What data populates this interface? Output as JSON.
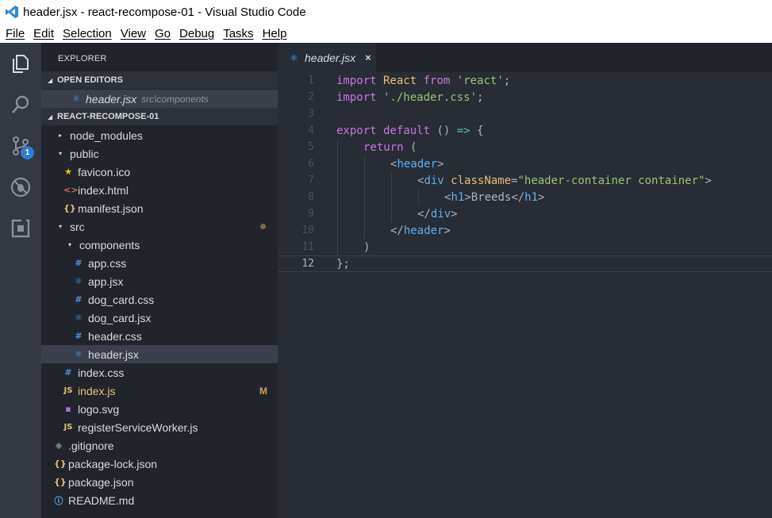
{
  "window": {
    "title": "header.jsx - react-recompose-01 - Visual Studio Code"
  },
  "menu": [
    "File",
    "Edit",
    "Selection",
    "View",
    "Go",
    "Debug",
    "Tasks",
    "Help"
  ],
  "activity": {
    "scm_badge": "1"
  },
  "sidebar": {
    "title": "EXPLORER",
    "open_editors_label": "OPEN EDITORS",
    "open_editor": {
      "name": "header.jsx",
      "path": "src\\components"
    },
    "project_label": "REACT-RECOMPOSE-01",
    "tree": [
      {
        "name": "node_modules",
        "icon": "",
        "arrow": "▸"
      },
      {
        "name": "public",
        "icon": "",
        "arrow": "▾"
      },
      {
        "name": "favicon.ico",
        "icon": "★"
      },
      {
        "name": "index.html",
        "icon": "<>"
      },
      {
        "name": "manifest.json",
        "icon": "{}"
      },
      {
        "name": "src",
        "icon": "",
        "arrow": "▾"
      },
      {
        "name": "components",
        "icon": "",
        "arrow": "▾"
      },
      {
        "name": "app.css",
        "icon": "#"
      },
      {
        "name": "app.jsx",
        "icon": "⚛"
      },
      {
        "name": "dog_card.css",
        "icon": "#"
      },
      {
        "name": "dog_card.jsx",
        "icon": "⚛"
      },
      {
        "name": "header.css",
        "icon": "#"
      },
      {
        "name": "header.jsx",
        "icon": "⚛"
      },
      {
        "name": "index.css",
        "icon": "#"
      },
      {
        "name": "index.js",
        "icon": "JS",
        "status": "M"
      },
      {
        "name": "logo.svg",
        "icon": "▪"
      },
      {
        "name": "registerServiceWorker.js",
        "icon": "JS"
      },
      {
        "name": ".gitignore",
        "icon": "◆"
      },
      {
        "name": "package-lock.json",
        "icon": "{}"
      },
      {
        "name": "package.json",
        "icon": "{}"
      },
      {
        "name": "README.md",
        "icon": "ⓘ"
      }
    ]
  },
  "tab": {
    "name": "header.jsx",
    "close": "×"
  },
  "editor": {
    "line_numbers": [
      "1",
      "2",
      "3",
      "4",
      "5",
      "6",
      "7",
      "8",
      "9",
      "10",
      "11",
      "12"
    ],
    "lines": [
      {
        "kw": "import",
        "mid": " React ",
        "kw2": "from",
        "str": " 'react'",
        "end": ";"
      },
      {
        "kw": "import",
        "str": " './header.css'",
        "end": ";"
      },
      {},
      {
        "kw": "export",
        "kw2": " default",
        "pun": " () ",
        "op": "=>",
        "end": " {"
      },
      {
        "kw": "return",
        "end": " ("
      },
      {
        "open": "<",
        "tag": "header",
        "close": ">"
      },
      {
        "open": "<",
        "tag": "div",
        "attr": "className",
        "eq": "=",
        "str": "\"header-container container\"",
        "close": ">"
      },
      {
        "open": "<",
        "tag": "h1",
        "close": ">",
        "text": "Breeds",
        "open2": "</",
        "tag2": "h1",
        "close2": ">"
      },
      {
        "open": "</",
        "tag": "div",
        "close": ">"
      },
      {
        "open": "</",
        "tag": "header",
        "close": ">"
      },
      {
        "end": ")"
      },
      {
        "end": "};"
      }
    ]
  }
}
